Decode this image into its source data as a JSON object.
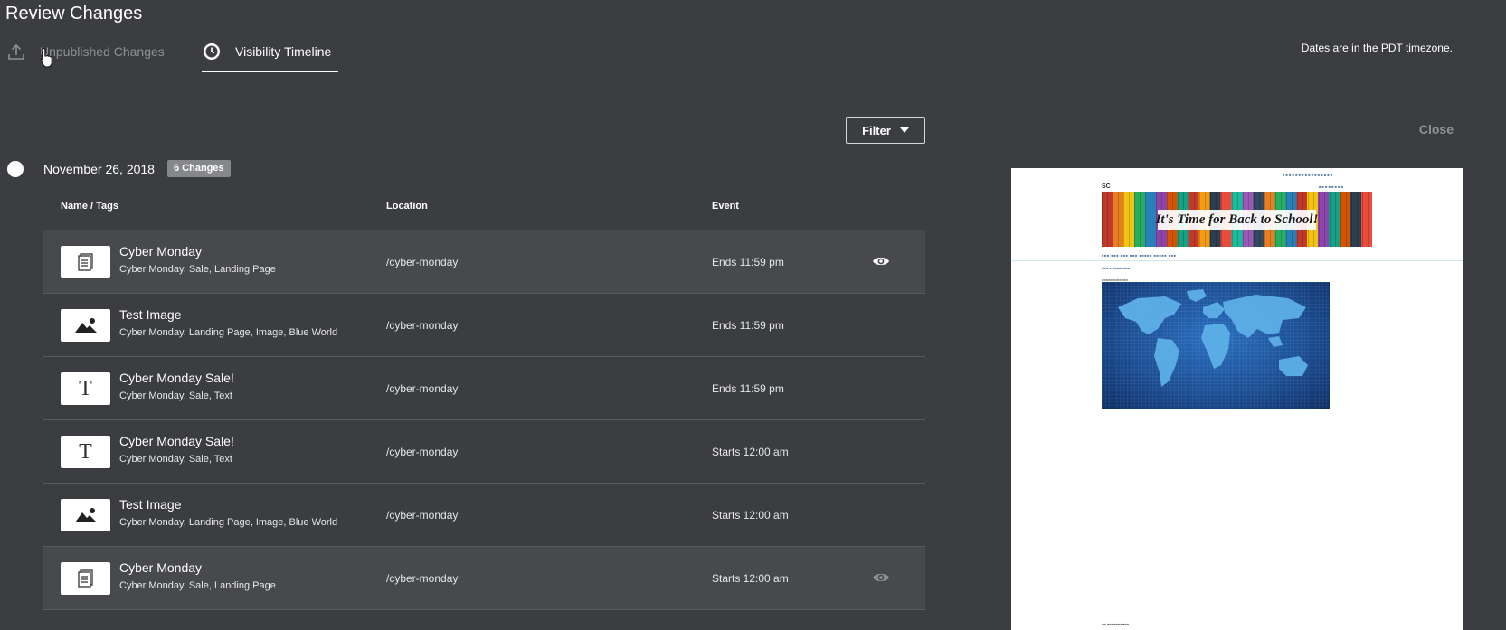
{
  "header": {
    "title": "Review Changes",
    "timezone_note": "Dates are in the PDT timezone."
  },
  "tabs": [
    {
      "label": "Unpublished Changes",
      "icon": "upload-icon",
      "active": false
    },
    {
      "label": "Visibility Timeline",
      "icon": "clock-icon",
      "active": true
    }
  ],
  "toolbar": {
    "filter_label": "Filter",
    "close_label": "Close"
  },
  "timeline": {
    "date": "November 26, 2018",
    "changes_badge": "6 Changes"
  },
  "table": {
    "columns": [
      "Name / Tags",
      "Location",
      "Event"
    ],
    "rows": [
      {
        "name": "Cyber Monday",
        "tags": "Cyber Monday, Sale, Landing Page",
        "location": "/cyber-monday",
        "event": "Ends 11:59 pm",
        "type_icon": "document-icon",
        "eye": "active"
      },
      {
        "name": "Test Image",
        "tags": "Cyber Monday, Landing Page, Image, Blue World",
        "location": "/cyber-monday",
        "event": "Ends 11:59 pm",
        "type_icon": "image-icon",
        "eye": "none"
      },
      {
        "name": "Cyber Monday Sale!",
        "tags": "Cyber Monday, Sale, Text",
        "location": "/cyber-monday",
        "event": "Ends 11:59 pm",
        "type_icon": "text-icon",
        "eye": "none"
      },
      {
        "name": "Cyber Monday Sale!",
        "tags": "Cyber Monday, Sale, Text",
        "location": "/cyber-monday",
        "event": "Starts 12:00 am",
        "type_icon": "text-icon",
        "eye": "none"
      },
      {
        "name": "Test Image",
        "tags": "Cyber Monday, Landing Page, Image, Blue World",
        "location": "/cyber-monday",
        "event": "Starts 12:00 am",
        "type_icon": "image-icon",
        "eye": "none"
      },
      {
        "name": "Cyber Monday",
        "tags": "Cyber Monday, Sale, Landing Page",
        "location": "/cyber-monday",
        "event": "Starts 12:00 am",
        "type_icon": "document-icon",
        "eye": "dim"
      }
    ],
    "text_glyph": "T"
  },
  "preview": {
    "banner_text": "It's Time for Back to School!",
    "logo_text": "SC"
  },
  "colors": {
    "background": "#3c3d41",
    "row_highlight": "#48494d",
    "badge": "#85878c",
    "muted": "#8e9096"
  }
}
